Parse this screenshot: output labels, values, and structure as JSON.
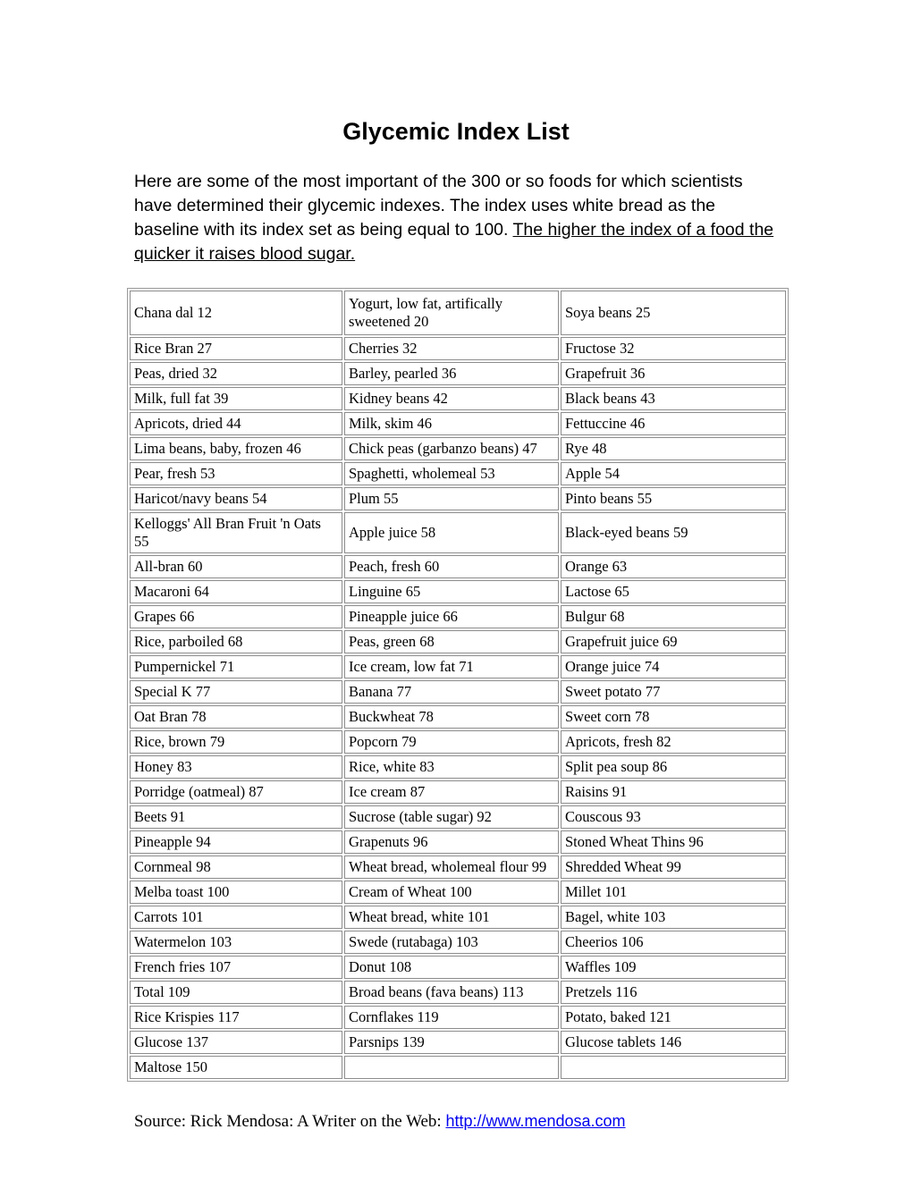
{
  "document": {
    "title": "Glycemic Index List",
    "intro": {
      "plain": "Here are some of the most important of the 300 or so foods for which scientists have determined their glycemic indexes. The index uses white bread as the baseline with its index set as being equal to 100. ",
      "underlined": "The higher the index of a food the quicker it raises blood sugar."
    },
    "source": {
      "prefix": "Source: Rick Mendosa: A Writer on the Web: ",
      "link_text": "http://www.mendosa.com",
      "link_color": "#0000ee"
    }
  },
  "table": {
    "columns": 3,
    "rows": [
      [
        "Chana dal 12",
        "Yogurt, low fat, artifically sweetened 20",
        "Soya beans 25"
      ],
      [
        "Rice Bran 27",
        "Cherries 32",
        "Fructose 32"
      ],
      [
        "Peas, dried 32",
        "Barley, pearled 36",
        "Grapefruit 36"
      ],
      [
        "Milk, full fat 39",
        "Kidney beans 42",
        "Black beans 43"
      ],
      [
        "Apricots, dried 44",
        "Milk, skim 46",
        "Fettuccine 46"
      ],
      [
        "Lima beans, baby, frozen 46",
        "Chick peas (garbanzo beans) 47",
        "Rye 48"
      ],
      [
        "Pear, fresh 53",
        "Spaghetti, wholemeal 53",
        "Apple 54"
      ],
      [
        "Haricot/navy beans 54",
        "Plum 55",
        "Pinto beans 55"
      ],
      [
        "Kelloggs' All Bran Fruit 'n Oats 55",
        "Apple juice 58",
        "Black-eyed beans 59"
      ],
      [
        "All-bran 60",
        "Peach, fresh 60",
        "Orange 63"
      ],
      [
        "Macaroni 64",
        "Linguine 65",
        "Lactose 65"
      ],
      [
        "Grapes 66",
        "Pineapple juice 66",
        "Bulgur 68"
      ],
      [
        "Rice, parboiled 68",
        "Peas, green 68",
        "Grapefruit juice 69"
      ],
      [
        "Pumpernickel 71",
        "Ice cream, low fat 71",
        "Orange juice 74"
      ],
      [
        "Special K 77",
        "Banana 77",
        "Sweet potato 77"
      ],
      [
        "Oat Bran 78",
        "Buckwheat 78",
        "Sweet corn 78"
      ],
      [
        "Rice, brown 79",
        "Popcorn 79",
        "Apricots, fresh 82"
      ],
      [
        "Honey 83",
        "Rice, white 83",
        "Split pea soup 86"
      ],
      [
        "Porridge (oatmeal) 87",
        "Ice cream 87",
        "Raisins 91"
      ],
      [
        "Beets 91",
        "Sucrose (table sugar) 92",
        "Couscous 93"
      ],
      [
        "Pineapple 94",
        "Grapenuts 96",
        "Stoned Wheat Thins 96"
      ],
      [
        "Cornmeal 98",
        "Wheat bread, wholemeal flour 99",
        "Shredded Wheat 99"
      ],
      [
        "Melba toast 100",
        "Cream of Wheat 100",
        "Millet 101"
      ],
      [
        "Carrots 101",
        "Wheat bread, white 101",
        "Bagel, white 103"
      ],
      [
        "Watermelon 103",
        "Swede (rutabaga) 103",
        "Cheerios 106"
      ],
      [
        "French fries 107",
        "Donut 108",
        "Waffles 109"
      ],
      [
        "Total 109",
        "Broad beans (fava beans) 113",
        "Pretzels 116"
      ],
      [
        "Rice Krispies 117",
        "Cornflakes 119",
        "Potato, baked 121"
      ],
      [
        "Glucose 137",
        "Parsnips 139",
        "Glucose tablets 146"
      ],
      [
        "Maltose 150",
        "",
        ""
      ]
    ]
  }
}
